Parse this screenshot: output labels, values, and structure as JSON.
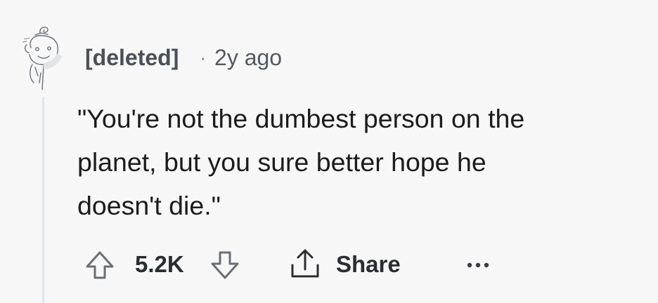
{
  "comment": {
    "author": "[deleted]",
    "separator": "·",
    "time": "2y ago",
    "body": "\"You're not the dumbest person on the\nplanet, but you sure better hope he\ndoesn't die.\"",
    "score": "5.2K",
    "share_label": "Share"
  },
  "icons": {
    "avatar": "snoo-avatar-sketch",
    "upvote": "arrow-up-outline-icon",
    "downvote": "arrow-down-outline-icon",
    "share": "share-upload-icon",
    "more": "more-horizontal-icon"
  },
  "colors": {
    "background": "#f7f7f8",
    "thread_line": "#dfe6ee",
    "text": "#1c1c1d",
    "meta": "#55595f"
  }
}
